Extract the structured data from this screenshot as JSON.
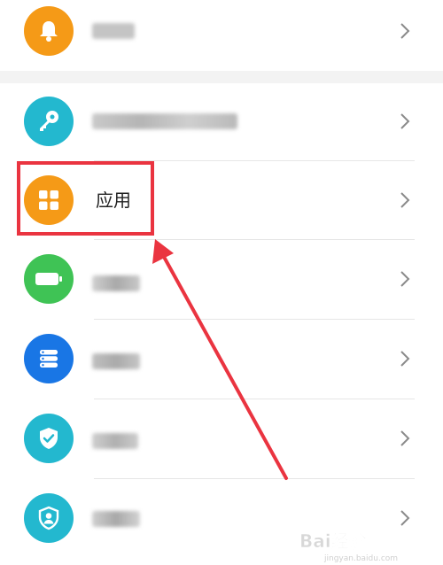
{
  "settings_list": {
    "items": [
      {
        "key": "notifications",
        "label": "",
        "icon": "bell-icon",
        "color": "#f59a17",
        "obscured": true
      },
      {
        "key": "security",
        "label": "",
        "icon": "key-icon",
        "color": "#23b8cf",
        "obscured": true
      },
      {
        "key": "apps",
        "label": "应用",
        "icon": "apps-grid-icon",
        "color": "#f59a17",
        "obscured": false
      },
      {
        "key": "battery",
        "label": "",
        "icon": "battery-icon",
        "color": "#3fc355",
        "obscured": true
      },
      {
        "key": "storage",
        "label": "",
        "icon": "storage-icon",
        "color": "#1976e5",
        "obscured": true
      },
      {
        "key": "safety",
        "label": "",
        "icon": "shield-check-icon",
        "color": "#23b8cf",
        "obscured": true
      },
      {
        "key": "privacy",
        "label": "",
        "icon": "user-shield-icon",
        "color": "#23b8cf",
        "obscured": true
      }
    ]
  },
  "annotation": {
    "highlight_color": "#ea3440"
  },
  "watermark": {
    "text": "Bai经验",
    "subtext": "jingyan.baidu.com"
  },
  "colors": {
    "chevron": "#8a8a8a",
    "divider": "#e6e6e6",
    "group_gap": "#f3f3f3"
  }
}
